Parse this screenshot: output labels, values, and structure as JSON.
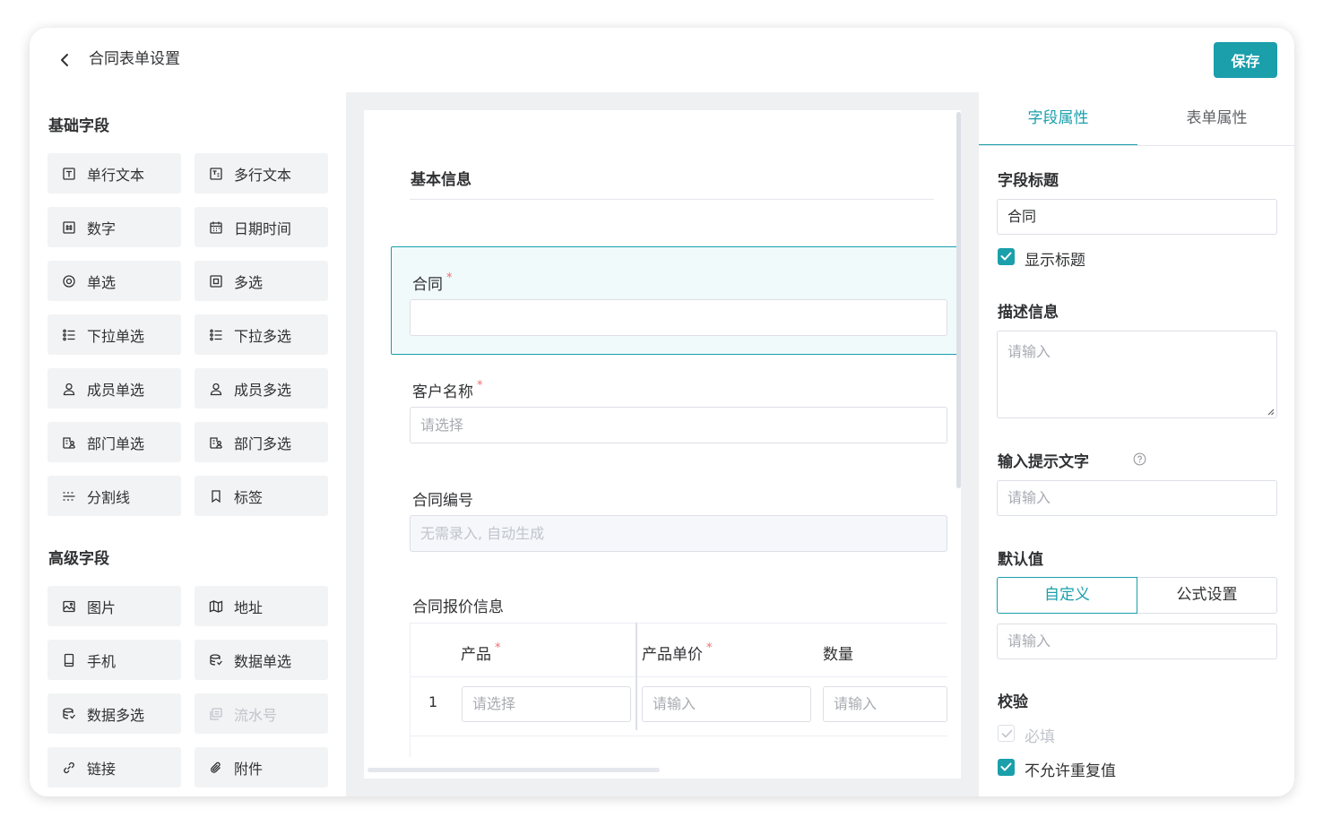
{
  "header": {
    "title": "合同表单设置",
    "save_label": "保存"
  },
  "basic_fields": {
    "title": "基础字段",
    "items": [
      {
        "label": "单行文本",
        "icon": "single-line-text-icon"
      },
      {
        "label": "多行文本",
        "icon": "multi-line-text-icon"
      },
      {
        "label": "数字",
        "icon": "number-icon"
      },
      {
        "label": "日期时间",
        "icon": "calendar-icon"
      },
      {
        "label": "单选",
        "icon": "radio-icon"
      },
      {
        "label": "多选",
        "icon": "checkbox-icon"
      },
      {
        "label": "下拉单选",
        "icon": "list-icon"
      },
      {
        "label": "下拉多选",
        "icon": "list-icon"
      },
      {
        "label": "成员单选",
        "icon": "user-icon"
      },
      {
        "label": "成员多选",
        "icon": "user-icon"
      },
      {
        "label": "部门单选",
        "icon": "department-icon"
      },
      {
        "label": "部门多选",
        "icon": "department-icon"
      },
      {
        "label": "分割线",
        "icon": "divider-icon"
      },
      {
        "label": "标签",
        "icon": "bookmark-icon"
      }
    ]
  },
  "advanced_fields": {
    "title": "高级字段",
    "items": [
      {
        "label": "图片",
        "icon": "image-icon"
      },
      {
        "label": "地址",
        "icon": "map-icon"
      },
      {
        "label": "手机",
        "icon": "phone-icon"
      },
      {
        "label": "数据单选",
        "icon": "database-icon"
      },
      {
        "label": "数据多选",
        "icon": "database-icon"
      },
      {
        "label": "流水号",
        "icon": "serial-number-icon",
        "disabled": true
      },
      {
        "label": "链接",
        "icon": "link-icon"
      },
      {
        "label": "附件",
        "icon": "attachment-icon"
      }
    ]
  },
  "canvas": {
    "group_title": "基本信息",
    "fields": {
      "contract": {
        "label": "合同",
        "required_mark": "*",
        "value": ""
      },
      "customer": {
        "label": "客户名称",
        "required_mark": "*",
        "placeholder": "请选择"
      },
      "number": {
        "label": "合同编号",
        "placeholder": "无需录入, 自动生成"
      }
    },
    "table": {
      "label": "合同报价信息",
      "columns": [
        {
          "label": "产品",
          "required_mark": "*"
        },
        {
          "label": "产品单价",
          "required_mark": "*"
        },
        {
          "label": "数量",
          "required_mark": ""
        }
      ],
      "rows": [
        {
          "index": "1",
          "cells": [
            "请选择",
            "请输入",
            "请输入"
          ]
        }
      ]
    }
  },
  "properties": {
    "tabs": [
      "字段属性",
      "表单属性"
    ],
    "active_tab": "字段属性",
    "field_title_label": "字段标题",
    "field_title_value": "合同",
    "show_title_label": "显示标题",
    "show_title_checked": true,
    "description_label": "描述信息",
    "description_placeholder": "请输入",
    "hint_label": "输入提示文字",
    "hint_placeholder": "请输入",
    "default_label": "默认值",
    "default_modes": [
      "自定义",
      "公式设置"
    ],
    "default_placeholder": "请输入",
    "validation_label": "校验",
    "required_label": "必填",
    "required_checked": true,
    "required_disabled": true,
    "unique_label": "不允许重复值",
    "unique_checked": true
  },
  "colors": {
    "accent": "#1a9fab",
    "required": "#f56c6c"
  }
}
